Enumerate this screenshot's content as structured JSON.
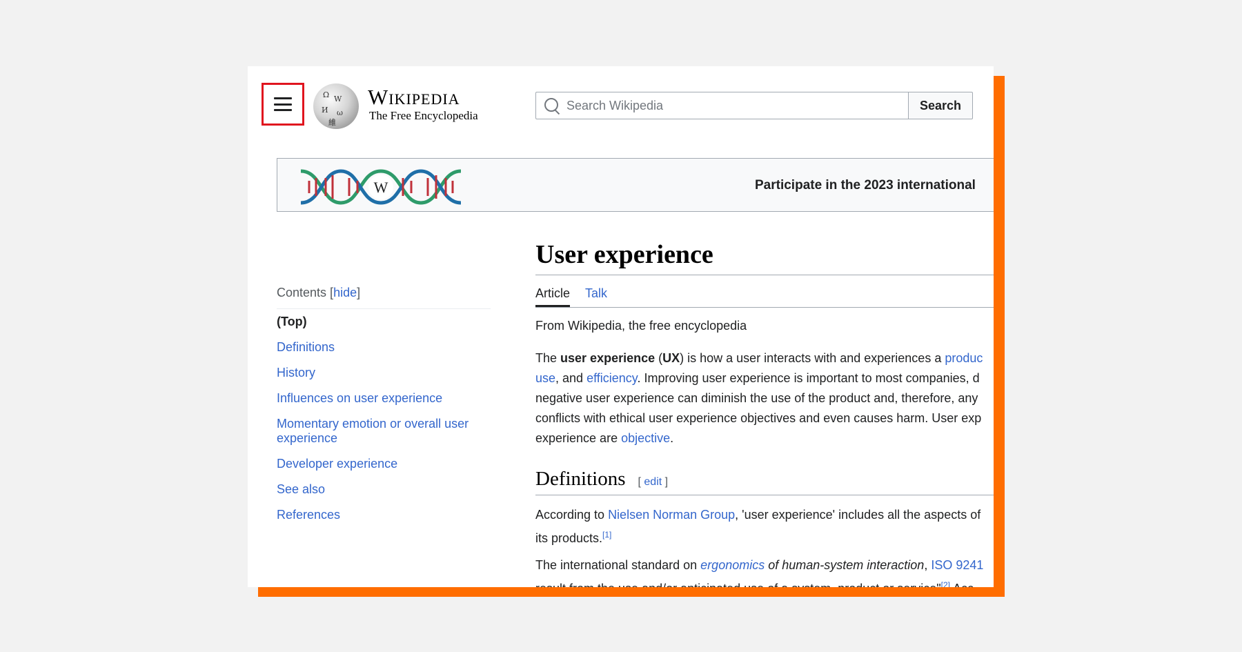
{
  "header": {
    "wordmark": "Wikipedia",
    "tagline": "The Free Encyclopedia",
    "search_placeholder": "Search Wikipedia",
    "search_button": "Search"
  },
  "banner": {
    "text": "Participate in the 2023 international"
  },
  "toc": {
    "heading": "Contents",
    "hide_link": "hide",
    "items": [
      {
        "label": "(Top)"
      },
      {
        "label": "Definitions"
      },
      {
        "label": "History"
      },
      {
        "label": "Influences on user experience"
      },
      {
        "label": "Momentary emotion or overall user experience"
      },
      {
        "label": "Developer experience"
      },
      {
        "label": "See also"
      },
      {
        "label": "References"
      }
    ]
  },
  "article": {
    "title": "User experience",
    "tabs": [
      "Article",
      "Talk"
    ],
    "tagline": "From Wikipedia, the free encyclopedia",
    "intro": {
      "l1_a": "The ",
      "l1_bold1": "user experience",
      "l1_b": " (",
      "l1_bold2": "UX",
      "l1_c": ") is how a user interacts with and experiences a ",
      "l1_link": "produc",
      "l2_link1": "use",
      "l2_a": ", and ",
      "l2_link2": "efficiency",
      "l2_b": ". Improving user experience is important to most companies, d",
      "l3": "negative user experience can diminish the use of the product and, therefore, any",
      "l4": "conflicts with ethical user experience objectives and even causes harm. User exp",
      "l5_a": "experience are ",
      "l5_link": "objective",
      "l5_b": "."
    },
    "section_heading": "Definitions",
    "edit_link": "edit",
    "def1": {
      "a": "According to ",
      "link": "Nielsen Norman Group",
      "b": ", 'user experience' includes all the aspects of",
      "c": "its products.",
      "ref": "[1]"
    },
    "def2": {
      "a": "The international standard on ",
      "link1": "ergonomics",
      "b": " of human-system interaction",
      "c": ", ",
      "link2": "ISO 9241",
      "d": "result from the use and/or anticipated use of a system, product or service\"",
      "ref": "[2]",
      "e": " Acc"
    }
  }
}
